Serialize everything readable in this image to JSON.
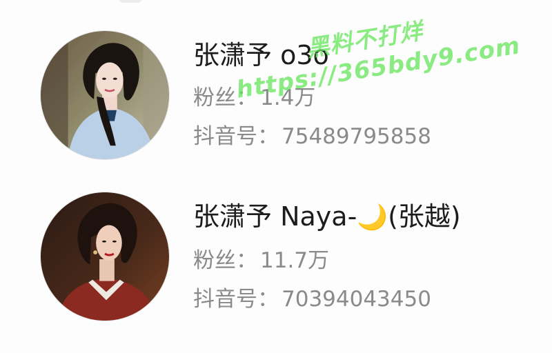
{
  "users": [
    {
      "name": "张潇予 o3o",
      "fans_label": "粉丝：",
      "fans_value": "1.4万",
      "id_label": "抖音号：",
      "id_value": "75489795858"
    },
    {
      "name": "张潇予 Naya-",
      "name_emoji": "🌙",
      "name_suffix": "(张越)",
      "fans_label": "粉丝：",
      "fans_value": "11.7万",
      "id_label": "抖音号：",
      "id_value": "70394043450"
    }
  ],
  "watermark": {
    "line1": "黑料不打烊",
    "line2": "https://365bdy9.com"
  },
  "icons": {
    "avatar_1": "avatar-woman-blue-qipao",
    "avatar_2": "avatar-woman-red-lips"
  },
  "colors": {
    "name_text": "#1c1c1c",
    "meta_text": "#8a8a8a",
    "watermark": "#69e65f"
  }
}
